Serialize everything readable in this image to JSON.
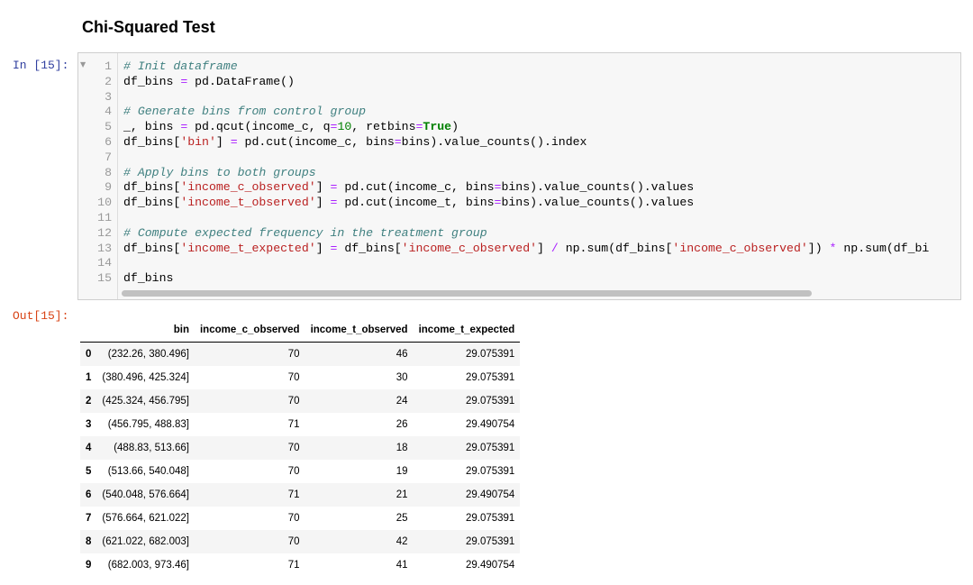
{
  "notebook": {
    "heading": "Chi-Squared Test",
    "in_prompt": "In [15]:",
    "out_prompt": "Out[15]:",
    "code_lines": [
      {
        "n": "1",
        "text": "# Init dataframe"
      },
      {
        "n": "2",
        "text": "df_bins = pd.DataFrame()"
      },
      {
        "n": "3",
        "text": ""
      },
      {
        "n": "4",
        "text": "# Generate bins from control group"
      },
      {
        "n": "5",
        "text": "_, bins = pd.qcut(income_c, q=10, retbins=True)"
      },
      {
        "n": "6",
        "text": "df_bins['bin'] = pd.cut(income_c, bins=bins).value_counts().index"
      },
      {
        "n": "7",
        "text": ""
      },
      {
        "n": "8",
        "text": "# Apply bins to both groups"
      },
      {
        "n": "9",
        "text": "df_bins['income_c_observed'] = pd.cut(income_c, bins=bins).value_counts().values"
      },
      {
        "n": "10",
        "text": "df_bins['income_t_observed'] = pd.cut(income_t, bins=bins).value_counts().values"
      },
      {
        "n": "11",
        "text": ""
      },
      {
        "n": "12",
        "text": "# Compute expected frequency in the treatment group"
      },
      {
        "n": "13",
        "text": "df_bins['income_t_expected'] = df_bins['income_c_observed'] / np.sum(df_bins['income_c_observed']) * np.sum(df_bi"
      },
      {
        "n": "14",
        "text": ""
      },
      {
        "n": "15",
        "text": "df_bins"
      }
    ]
  },
  "output_table": {
    "columns": [
      "",
      "bin",
      "income_c_observed",
      "income_t_observed",
      "income_t_expected"
    ],
    "rows": [
      {
        "index": "0",
        "bin": "(232.26, 380.496]",
        "c_obs": "70",
        "t_obs": "46",
        "t_exp": "29.075391"
      },
      {
        "index": "1",
        "bin": "(380.496, 425.324]",
        "c_obs": "70",
        "t_obs": "30",
        "t_exp": "29.075391"
      },
      {
        "index": "2",
        "bin": "(425.324, 456.795]",
        "c_obs": "70",
        "t_obs": "24",
        "t_exp": "29.075391"
      },
      {
        "index": "3",
        "bin": "(456.795, 488.83]",
        "c_obs": "71",
        "t_obs": "26",
        "t_exp": "29.490754"
      },
      {
        "index": "4",
        "bin": "(488.83, 513.66]",
        "c_obs": "70",
        "t_obs": "18",
        "t_exp": "29.075391"
      },
      {
        "index": "5",
        "bin": "(513.66, 540.048]",
        "c_obs": "70",
        "t_obs": "19",
        "t_exp": "29.075391"
      },
      {
        "index": "6",
        "bin": "(540.048, 576.664]",
        "c_obs": "71",
        "t_obs": "21",
        "t_exp": "29.490754"
      },
      {
        "index": "7",
        "bin": "(576.664, 621.022]",
        "c_obs": "70",
        "t_obs": "25",
        "t_exp": "29.075391"
      },
      {
        "index": "8",
        "bin": "(621.022, 682.003]",
        "c_obs": "70",
        "t_obs": "42",
        "t_exp": "29.075391"
      },
      {
        "index": "9",
        "bin": "(682.003, 973.46]",
        "c_obs": "71",
        "t_obs": "41",
        "t_exp": "29.490754"
      }
    ]
  },
  "icons": {
    "fold": "fold-triangle-icon"
  }
}
